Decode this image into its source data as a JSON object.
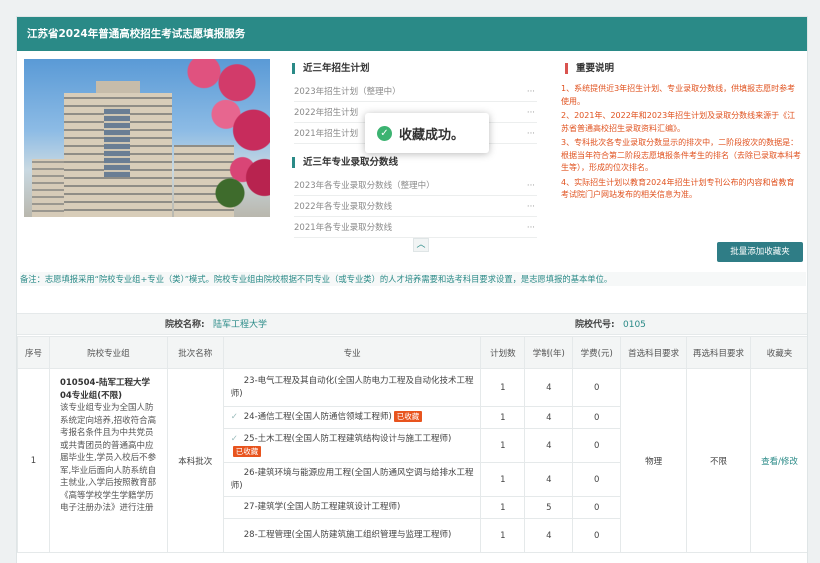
{
  "header": {
    "title": "江苏省2024年普通高校招生考试志愿填报服务"
  },
  "plan": {
    "title": "近三年招生计划",
    "items": [
      {
        "label": "2023年招生计划（整理中）",
        "more": "···"
      },
      {
        "label": "2022年招生计划",
        "more": "···"
      },
      {
        "label": "2021年招生计划",
        "more": "···"
      }
    ]
  },
  "scores": {
    "title": "近三年专业录取分数线",
    "items": [
      {
        "label": "2023年各专业录取分数线（整理中）",
        "more": "···"
      },
      {
        "label": "2022年各专业录取分数线",
        "more": "···"
      },
      {
        "label": "2021年各专业录取分数线",
        "more": "···"
      }
    ]
  },
  "notes": {
    "title": "重要说明",
    "items": [
      "1、系统提供近3年招生计划、专业录取分数线，供填报志愿时参考使用。",
      "2、2021年、2022年和2023年招生计划及录取分数线来源于《江苏省普通高校招生录取资料汇编》。",
      "3、专科批次各专业录取分数显示的排次中，二阶段按次的数据是：根据当年符合第二阶段志愿填报条件考生的排名（去除已录取本科考生等），形成的位次排名。",
      "4、实际招生计划以教育2024年招生计划专刊公布的内容和省教育考试院门户网站发布的相关信息为准。"
    ]
  },
  "toast": {
    "icon": "check-circle-icon",
    "message": "收藏成功。"
  },
  "collapse": {
    "icon": "chevron-up-icon",
    "glyph": "︿"
  },
  "batch_button": "批量添加收藏夹",
  "remark": "备注：志愿填报采用“院校专业组+专业（类）”模式。院校专业组由院校根据不同专业（或专业类）的人才培养需要和选考科目要求设置，是志愿填报的基本单位。",
  "school": {
    "name_label": "院校名称:",
    "name": "陆军工程大学",
    "code_label": "院校代号:",
    "code": "0105"
  },
  "table": {
    "headers": [
      "序号",
      "院校专业组",
      "批次名称",
      "专业",
      "计划数",
      "学制(年)",
      "学费(元)",
      "首选科目要求",
      "再选科目要求",
      "收藏夹"
    ],
    "group": {
      "index": "1",
      "name": "010504-陆军工程大学04专业组(不限)",
      "desc": "该专业组专业为全国人防系统定向培养,招收符合高考报名条件且为中共党员或共青团员的普通高中应届毕业生,学员入校后不参军,毕业后面向人防系统自主就业,入学后按照教育部《高等学校学生学籍学历电子注册办法》进行注册",
      "batch": "本科批次",
      "first_subject": "物理",
      "second_subject": "不限",
      "action": "查看/修改"
    },
    "rows": [
      {
        "major": "23-电气工程及其自动化(全国人防电力工程及自动化技术工程师)",
        "plan": "1",
        "years": "4",
        "fee": "0",
        "checked": false,
        "tag": ""
      },
      {
        "major": "24-通信工程(全国人防通信领域工程师)",
        "plan": "1",
        "years": "4",
        "fee": "0",
        "checked": true,
        "tag": "已收藏"
      },
      {
        "major": "25-土木工程(全国人防工程建筑结构设计与施工工程师)",
        "plan": "1",
        "years": "4",
        "fee": "0",
        "checked": true,
        "tag": "已收藏"
      },
      {
        "major": "26-建筑环境与能源应用工程(全国人防通风空调与给排水工程师)",
        "plan": "1",
        "years": "4",
        "fee": "0",
        "checked": false,
        "tag": ""
      },
      {
        "major": "27-建筑学(全国人防工程建筑设计工程师)",
        "plan": "1",
        "years": "5",
        "fee": "0",
        "checked": false,
        "tag": ""
      },
      {
        "major": "28-工程管理(全国人防建筑施工组织管理与监理工程师)",
        "plan": "1",
        "years": "4",
        "fee": "0",
        "checked": false,
        "tag": ""
      }
    ]
  }
}
